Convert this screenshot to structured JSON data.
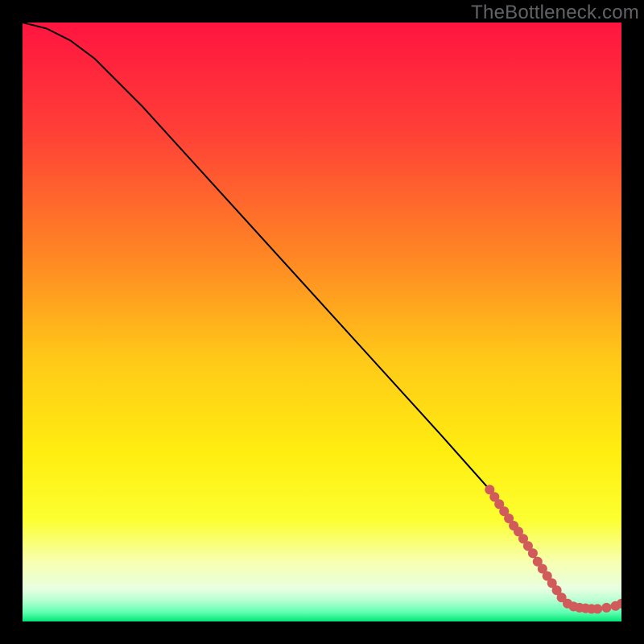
{
  "watermark": "TheBottleneck.com",
  "chart_data": {
    "type": "line",
    "title": "",
    "xlabel": "",
    "ylabel": "",
    "xlim": [
      0,
      100
    ],
    "ylim": [
      0,
      100
    ],
    "grid": false,
    "legend": false,
    "background_gradient_stops": [
      {
        "offset": 0.0,
        "color": "#ff1440"
      },
      {
        "offset": 0.18,
        "color": "#ff3f37"
      },
      {
        "offset": 0.4,
        "color": "#ff8a23"
      },
      {
        "offset": 0.56,
        "color": "#ffc818"
      },
      {
        "offset": 0.72,
        "color": "#ffee10"
      },
      {
        "offset": 0.83,
        "color": "#fcff30"
      },
      {
        "offset": 0.9,
        "color": "#f7ffb0"
      },
      {
        "offset": 0.945,
        "color": "#e8ffe0"
      },
      {
        "offset": 0.965,
        "color": "#b6ffd2"
      },
      {
        "offset": 0.985,
        "color": "#5fffb0"
      },
      {
        "offset": 1.0,
        "color": "#00e676"
      }
    ],
    "series": [
      {
        "name": "bottleneck-curve",
        "color": "#000000",
        "x": [
          0,
          4,
          8,
          12,
          20,
          30,
          40,
          50,
          60,
          70,
          78,
          83,
          86,
          88,
          90,
          93,
          96,
          100
        ],
        "y": [
          100,
          99,
          97,
          94,
          86,
          75,
          64,
          53,
          42,
          31,
          22,
          15,
          10,
          7,
          4,
          2.3,
          2.1,
          3.0
        ]
      }
    ],
    "scatter": {
      "name": "highlight-points",
      "color": "#d15a5a",
      "radius": 6,
      "points": [
        {
          "x": 78.0,
          "y": 22.0
        },
        {
          "x": 78.8,
          "y": 20.8
        },
        {
          "x": 79.6,
          "y": 19.6
        },
        {
          "x": 80.4,
          "y": 18.4
        },
        {
          "x": 81.2,
          "y": 17.2
        },
        {
          "x": 82.0,
          "y": 16.0
        },
        {
          "x": 82.8,
          "y": 15.0
        },
        {
          "x": 83.6,
          "y": 13.8
        },
        {
          "x": 84.4,
          "y": 12.6
        },
        {
          "x": 85.2,
          "y": 11.4
        },
        {
          "x": 86.0,
          "y": 10.0
        },
        {
          "x": 86.8,
          "y": 8.8
        },
        {
          "x": 87.6,
          "y": 7.6
        },
        {
          "x": 88.4,
          "y": 6.4
        },
        {
          "x": 89.2,
          "y": 5.2
        },
        {
          "x": 90.0,
          "y": 4.0
        },
        {
          "x": 91.0,
          "y": 3.0
        },
        {
          "x": 92.0,
          "y": 2.5
        },
        {
          "x": 93.0,
          "y": 2.3
        },
        {
          "x": 94.0,
          "y": 2.2
        },
        {
          "x": 95.0,
          "y": 2.1
        },
        {
          "x": 96.0,
          "y": 2.1
        },
        {
          "x": 97.5,
          "y": 2.3
        },
        {
          "x": 99.0,
          "y": 2.6
        },
        {
          "x": 100.0,
          "y": 3.0
        }
      ]
    }
  }
}
